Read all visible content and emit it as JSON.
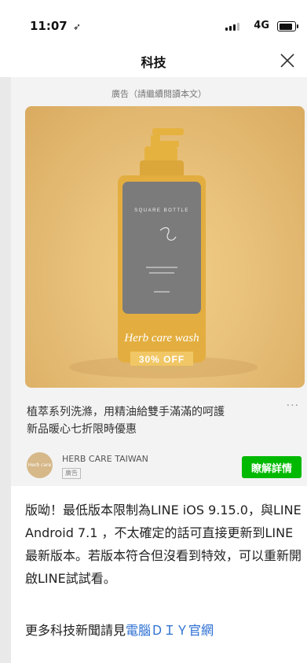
{
  "status": {
    "time": "11:07",
    "location_glyph": "➶",
    "network": "4G"
  },
  "nav": {
    "title": "科技",
    "close_icon": "close-icon"
  },
  "ad": {
    "label": "廣告（請繼續閱讀本文）",
    "image": {
      "bottle_heading": "SQUARE BOTTLE",
      "script_text": "Herb care wash",
      "discount": "30% OFF"
    },
    "caption": "植萃系列洗滌，用精油給雙手滿滿的呵護\n新品暖心七折限時優惠",
    "more_icon": "more-icon",
    "advertiser": {
      "name": "HERB CARE TAIWAN",
      "badge": "廣告",
      "avatar_text": "Herb care"
    },
    "cta_label": "瞭解詳情",
    "cta_color": "#00b900"
  },
  "article": {
    "body": "版呦！最低版本限制為LINE iOS 9.15.0，與LINE Android 7.1 ，不太確定的話可直接更新到LINE最新版本。若版本符合但沒看到特效，可以重新開啟LINE試試看。",
    "more_prefix": "更多科技新聞請見",
    "more_link": "電腦ＤＩＹ官網"
  }
}
